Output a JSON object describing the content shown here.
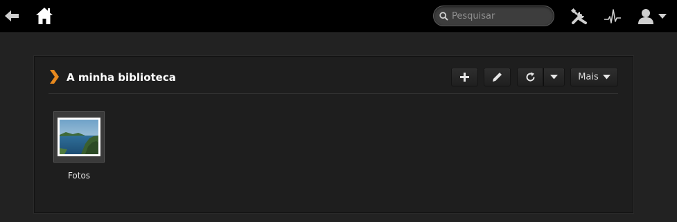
{
  "topbar": {
    "search_placeholder": "Pesquisar",
    "icons": {
      "back": "arrow-left-icon",
      "home": "home-icon",
      "search": "search-icon",
      "tools": "tools-icon",
      "activity": "activity-icon",
      "user": "user-icon"
    }
  },
  "library": {
    "title": "A minha biblioteca",
    "more_label": "Mais",
    "items": [
      {
        "label": "Fotos"
      }
    ]
  },
  "colors": {
    "accent": "#e8891e",
    "topbar_bg": "#000000",
    "page_bg": "#222222",
    "panel_bg": "#1e1e1e"
  }
}
